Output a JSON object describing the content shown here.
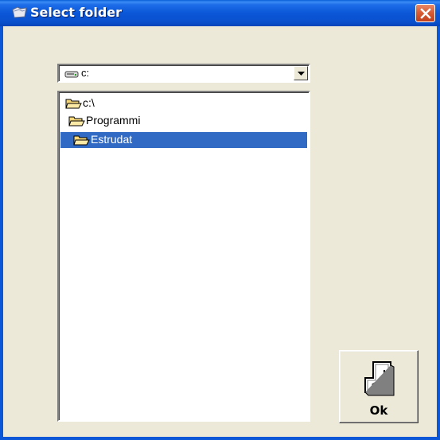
{
  "window": {
    "title": "Select folder",
    "icons": {
      "title": "folder-app-icon",
      "close": "close-icon"
    },
    "colors": {
      "titlebar": "#0b57d8",
      "face": "#ece9d8",
      "selection": "#316ac5",
      "close": "#d65a32"
    }
  },
  "drive_combo": {
    "value": "c:",
    "icon": "drive-icon",
    "arrow_icon": "chevron-down-icon"
  },
  "tree": {
    "items": [
      {
        "label": "c:\\",
        "icon": "open-folder-icon",
        "selected": false
      },
      {
        "label": "Programmi",
        "icon": "open-folder-icon",
        "selected": false
      },
      {
        "label": "Estrudat",
        "icon": "open-folder-icon",
        "selected": true
      }
    ]
  },
  "ok_button": {
    "label": "Ok",
    "icon": "enter-key-icon"
  }
}
